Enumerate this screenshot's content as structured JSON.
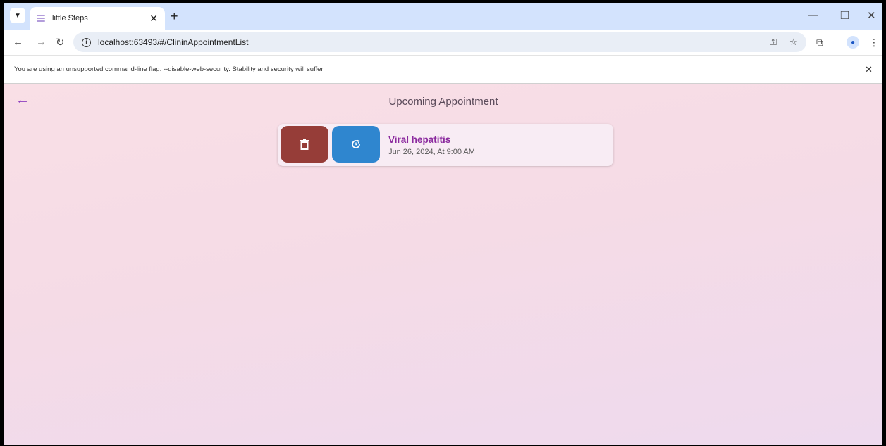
{
  "browser": {
    "tab_title": "little Steps",
    "url": "localhost:63493/#/ClininAppointmentList",
    "infobar_text": "You are using an unsupported command-line flag: --disable-web-security. Stability and security will suffer."
  },
  "app": {
    "title": "Upcoming Appointment",
    "appointments": [
      {
        "title": "Viral hepatitis",
        "datetime": "Jun 26, 2024,  At 9:00 AM"
      }
    ]
  },
  "colors": {
    "accent": "#8b2a9e",
    "delete": "#963d38",
    "reschedule": "#2f86cf"
  }
}
